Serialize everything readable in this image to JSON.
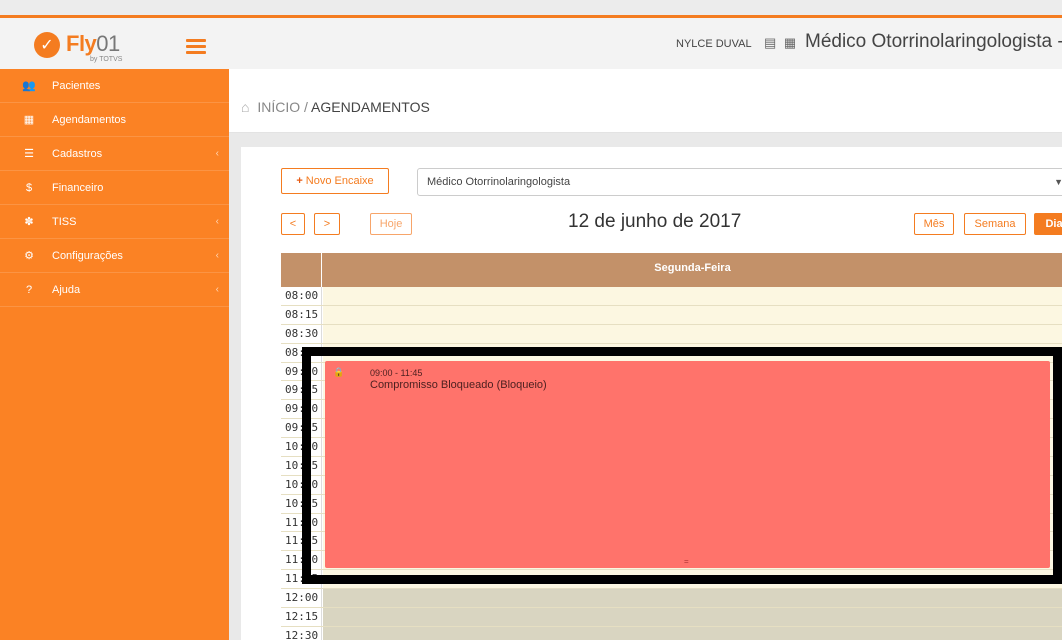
{
  "brand": {
    "name": "Fly",
    "suffix": "01",
    "tagline": "by TOTVS"
  },
  "sidebar": {
    "items": [
      {
        "label": "Pacientes",
        "icon": "users-icon",
        "glyph": "👥",
        "chevron": false
      },
      {
        "label": "Agendamentos",
        "icon": "calendar-icon",
        "glyph": "▦",
        "chevron": false
      },
      {
        "label": "Cadastros",
        "icon": "list-icon",
        "glyph": "☰",
        "chevron": true
      },
      {
        "label": "Financeiro",
        "icon": "dollar-icon",
        "glyph": "$",
        "chevron": false
      },
      {
        "label": "TISS",
        "icon": "handshake-icon",
        "glyph": "✽",
        "chevron": true
      },
      {
        "label": "Configurações",
        "icon": "gear-icon",
        "glyph": "⚙",
        "chevron": true
      },
      {
        "label": "Ajuda",
        "icon": "question-icon",
        "glyph": "?",
        "chevron": true
      }
    ],
    "chevron_glyph": "‹"
  },
  "header": {
    "user": "NYLCE DUVAL",
    "icons": "▤ ▦",
    "role": "Médico Otorrinolaringologista -"
  },
  "breadcrumb": {
    "home_glyph": "⌂",
    "home": "INÍCIO",
    "separator": " / ",
    "current": "AGENDAMENTOS"
  },
  "toolbar": {
    "novo_plus": "+",
    "novo_label": "Novo Encaixe",
    "select_value": "Médico Otorrinolaringologista",
    "select_caret": "▼",
    "prev_glyph": "<",
    "next_glyph": ">",
    "today_label": "Hoje",
    "date_title": "12 de junho de 2017",
    "view_month": "Mês",
    "view_week": "Semana",
    "view_day": "Dia"
  },
  "calendar": {
    "day_header": "Segunda-Feira",
    "times": [
      "08:00",
      "08:15",
      "08:30",
      "08:45",
      "09:00",
      "09:15",
      "09:30",
      "09:45",
      "10:00",
      "10:15",
      "10:30",
      "10:45",
      "11:00",
      "11:15",
      "11:30",
      "11:45",
      "12:00",
      "12:15",
      "12:30"
    ],
    "event": {
      "time": "09:00 - 11:45",
      "title": "Compromisso Bloqueado (Bloqueio)",
      "lock_glyph": "🔒",
      "handle": "="
    }
  },
  "colors": {
    "accent": "#f47c20",
    "sidebar": "#fb8224",
    "event": "#ff736b",
    "day_header": "#c39169",
    "slot": "#fcf7e1"
  }
}
